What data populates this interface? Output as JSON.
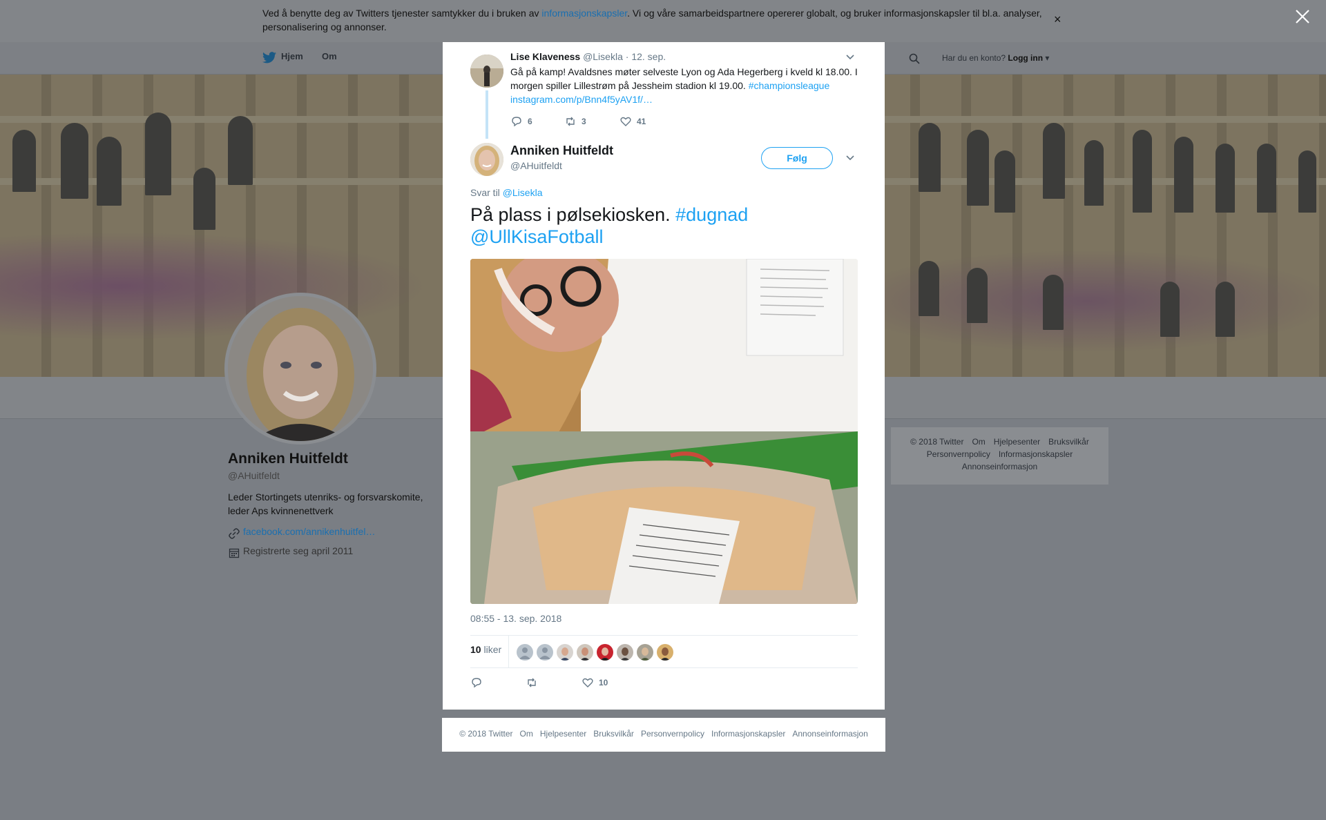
{
  "cookie_banner": {
    "text_before": "Ved å benytte deg av Twitters tjenester samtykker du i bruken av ",
    "link": "informasjonskapsler",
    "text_after": ". Vi og våre samarbeidspartnere opererer globalt, og bruker informasjonskapsler til bl.a. analyser, personalisering og annonser.",
    "close": "×"
  },
  "topbar": {
    "nav": [
      "Hjem",
      "Om"
    ],
    "login_question": "Har du en konto?",
    "login_link": "Logg inn"
  },
  "profile": {
    "name": "Anniken Huitfeldt",
    "handle": "@AHuitfeldt",
    "bio": "Leder Stortingets utenriks- og forsvarskomite, leder Aps kvinnenettverk",
    "link": "facebook.com/annikenhuitfel…",
    "joined": "Registrerte seg april 2011"
  },
  "side_footer": {
    "line1": [
      "© 2018 Twitter",
      "Om",
      "Hjelpesenter",
      "Bruksvilkår"
    ],
    "line2": [
      "Personvernpolicy",
      "Informasjonskapsler"
    ],
    "line3": [
      "Annonseinformasjon"
    ]
  },
  "parent_tweet": {
    "name": "Lise Klaveness",
    "handle": "@Lisekla",
    "date": "12. sep.",
    "text": "Gå på kamp! Avaldsnes møter selveste Lyon og Ada Hegerberg i kveld kl 18.00. I morgen spiller Lillestrøm på Jessheim stadion kl 19.00. ",
    "hashtag": "#championsleague",
    "link": "instagram.com/p/Bnn4f5yAV1f/…",
    "replies": "6",
    "retweets": "3",
    "likes": "41"
  },
  "main_tweet": {
    "name": "Anniken Huitfeldt",
    "handle": "@AHuitfeldt",
    "follow_label": "Følg",
    "reply_to_prefix": "Svar til ",
    "reply_to_handle": "@Lisekla",
    "text": "På plass i pølsekiosken. ",
    "hashtag": "#dugnad",
    "mention": "@UllKisaFotball",
    "timestamp": "08:55 - 13. sep. 2018",
    "like_count": "10",
    "like_label": "liker",
    "likes": "10",
    "likers": [
      "default-avatar",
      "default-avatar",
      "man-avatar",
      "man-avatar",
      "red-avatar",
      "man-avatar",
      "woman-avatar",
      "man-avatar"
    ]
  },
  "modal_footer": [
    "© 2018 Twitter",
    "Om",
    "Hjelpesenter",
    "Bruksvilkår",
    "Personvernpolicy",
    "Informasjonskapsler",
    "Annonseinformasjon"
  ],
  "colors": {
    "accent": "#1da1f2",
    "overlay": "#7a7e84",
    "muted": "#657786"
  }
}
